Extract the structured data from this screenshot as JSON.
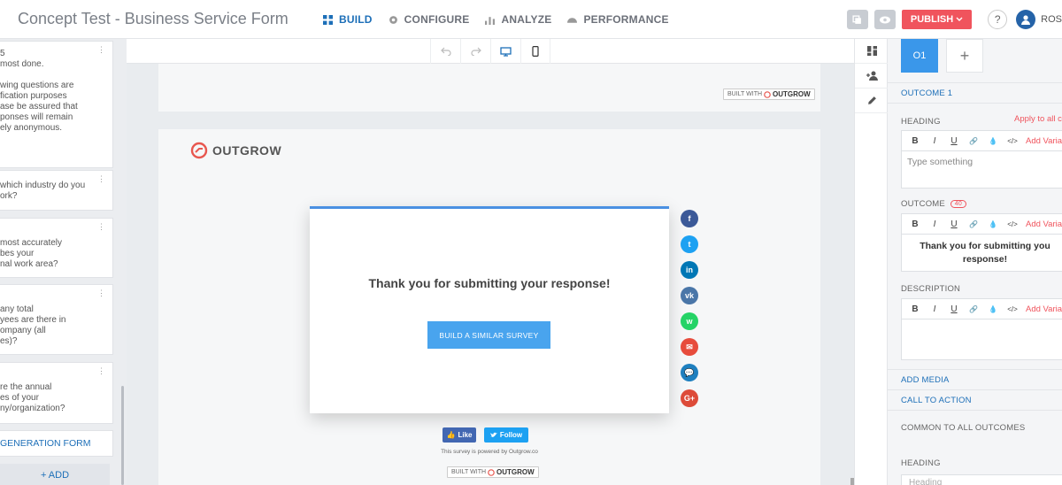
{
  "header": {
    "title": "Concept Test - Business Service Form",
    "nav": [
      {
        "label": "BUILD",
        "icon": "grid-icon",
        "active": true
      },
      {
        "label": "CONFIGURE",
        "icon": "gear-icon",
        "active": false
      },
      {
        "label": "ANALYZE",
        "icon": "bar-chart-icon",
        "active": false
      },
      {
        "label": "PERFORMANCE",
        "icon": "gauge-icon",
        "active": false
      }
    ],
    "publish_label": "PUBLISH",
    "help_label": "?",
    "user_name": "ROS"
  },
  "left_panel": {
    "questions": [
      {
        "text": "5\nmost done.\n\nwing questions are\nfication purposes\nase be assured that\nponses will remain\nely anonymous."
      },
      {
        "text": "which industry do you\nork?"
      },
      {
        "text": "most accurately\nbes your\nnal work area?"
      },
      {
        "text": "any total\nyees are there in\nompany (all\nes)?"
      },
      {
        "text": "re the annual\nes of your\nny/organization?"
      }
    ],
    "generation_form": "GENERATION FORM",
    "add_label": "+ ADD"
  },
  "canvas": {
    "built_with_label": "BUILT WITH",
    "built_with_brand": "OUTGROW",
    "logo_text": "OUTGROW",
    "modal": {
      "heading": "Thank you for submitting your response!",
      "cta_label": "BUILD A SIMILAR SURVEY"
    },
    "social": [
      {
        "name": "facebook-icon",
        "glyph": "f",
        "color": "#3b5998"
      },
      {
        "name": "twitter-icon",
        "glyph": "t",
        "color": "#1da1f2"
      },
      {
        "name": "linkedin-icon",
        "glyph": "in",
        "color": "#0077b5"
      },
      {
        "name": "vk-icon",
        "glyph": "vk",
        "color": "#4a76a8"
      },
      {
        "name": "whatsapp-icon",
        "glyph": "w",
        "color": "#25d366"
      },
      {
        "name": "email-icon",
        "glyph": "✉",
        "color": "#e74c3c"
      },
      {
        "name": "chat-icon",
        "glyph": "💬",
        "color": "#1e7fbf"
      },
      {
        "name": "google-plus-icon",
        "glyph": "G+",
        "color": "#dd4b39"
      }
    ],
    "like_label": "Like",
    "follow_label": "Follow",
    "powered_by": "This survey is powered by Outgrow.co"
  },
  "right_panel": {
    "tab_label": "O1",
    "tab_add": "+",
    "outcome_label": "OUTCOME 1",
    "heading_label": "HEADING",
    "apply_all": "Apply to all c",
    "add_variable": "Add Varial",
    "editor_buttons": [
      "B",
      "I",
      "U",
      "🔗",
      "💧",
      "</>"
    ],
    "heading_placeholder": "Type something",
    "outcome_field_label": "OUTCOME",
    "outcome_count": "40",
    "outcome_text": "Thank you for submitting you response!",
    "description_label": "DESCRIPTION",
    "add_media": "ADD MEDIA",
    "call_to_action": "CALL TO ACTION",
    "common_outcomes": "COMMON TO ALL OUTCOMES",
    "heading2_label": "HEADING",
    "heading2_placeholder": "Heading"
  }
}
